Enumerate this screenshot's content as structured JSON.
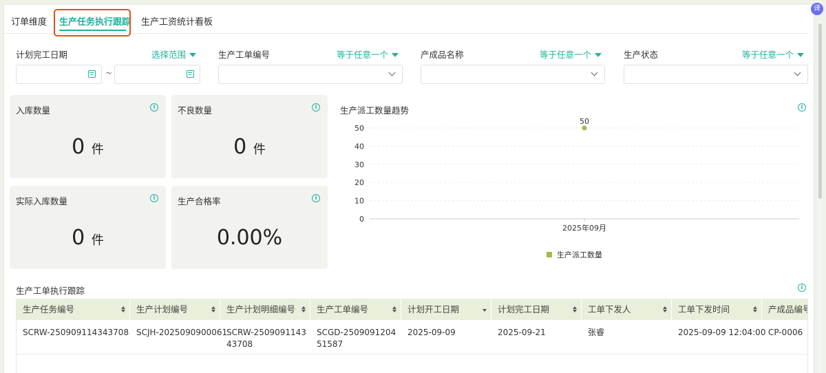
{
  "tabs": [
    {
      "label": "订单维度"
    },
    {
      "label": "生产任务执行跟踪"
    },
    {
      "label": "生产工资统计看板"
    }
  ],
  "filters": {
    "plan_finish_date": {
      "label": "计划完工日期",
      "op": "选择范围"
    },
    "work_order_no": {
      "label": "生产工单编号",
      "op": "等于任意一个"
    },
    "product_name": {
      "label": "产成品名称",
      "op": "等于任意一个"
    },
    "status": {
      "label": "生产状态",
      "op": "等于任意一个"
    },
    "range_sep": "~"
  },
  "cards": {
    "in_qty": {
      "title": "入库数量",
      "value": "0",
      "unit": "件"
    },
    "defect_qty": {
      "title": "不良数量",
      "value": "0",
      "unit": "件"
    },
    "actual_in_qty": {
      "title": "实际入库数量",
      "value": "0",
      "unit": "件"
    },
    "pass_rate": {
      "title": "生产合格率",
      "value": "0.00%"
    }
  },
  "info_glyph": "i",
  "chart_data": {
    "type": "line",
    "title": "生产派工数量趋势",
    "categories": [
      "2025年09月"
    ],
    "series": [
      {
        "name": "生产派工数量",
        "values": [
          50
        ],
        "color": "#a3b94a"
      }
    ],
    "ylim": [
      0,
      50
    ],
    "yticks": [
      0,
      10,
      20,
      30,
      40,
      50
    ],
    "data_labels": [
      "50"
    ],
    "grid": true,
    "legend": "bottom"
  },
  "table": {
    "title": "生产工单执行跟踪",
    "columns": [
      "生产任务编号",
      "生产计划编号",
      "生产计划明细编号",
      "生产工单编号",
      "计划开工日期",
      "计划完工日期",
      "工单下发人",
      "工单下发时间",
      "产成品编号"
    ],
    "rows": [
      [
        "SCRW-250909114343708",
        "SCJH-2025090900061",
        "SCRW-250909114343708",
        "SCGD-250909120451587",
        "2025-09-09",
        "2025-09-21",
        "张睿",
        "2025-09-09 12:04:00",
        "CP-0006"
      ]
    ]
  },
  "translate_btn": "译",
  "colors": {
    "accent": "#20b39b",
    "highlight": "#d9541f",
    "series": "#a3b94a"
  }
}
